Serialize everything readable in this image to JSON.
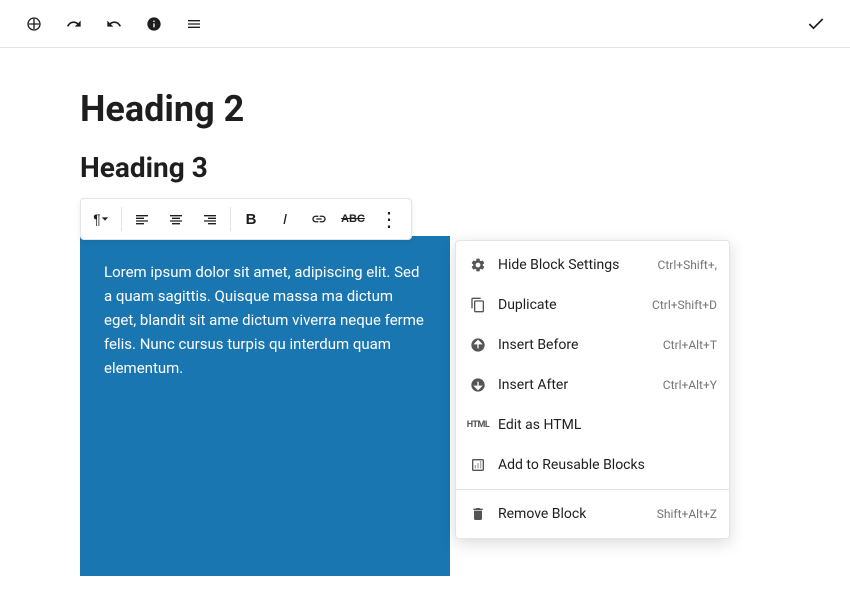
{
  "toolbar": {
    "add_icon": "⊕",
    "undo_icon": "↩",
    "redo_icon": "↪",
    "info_icon": "ⓘ",
    "list_icon": "≡",
    "check_icon": "✓"
  },
  "editor": {
    "heading2": "Heading 2",
    "heading3": "Heading 3",
    "content": "Lorem ipsum dolor sit amet, adipiscing elit. Sed a quam sagittis. Quisque massa ma dictum eget, blandit sit ame dictum viverra neque ferme felis. Nunc cursus turpis qu interdum quam elementum."
  },
  "block_toolbar": {
    "paragraph": "¶",
    "align_left": "≡",
    "align_center": "≡",
    "align_right": "≡",
    "bold": "B",
    "italic": "I",
    "link": "⛓",
    "strikethrough": "ABC",
    "more": "⋮"
  },
  "context_menu": {
    "items": [
      {
        "id": "hide-block-settings",
        "label": "Hide Block Settings",
        "shortcut": "Ctrl+Shift+,",
        "icon": "gear"
      },
      {
        "id": "duplicate",
        "label": "Duplicate",
        "shortcut": "Ctrl+Shift+D",
        "icon": "duplicate"
      },
      {
        "id": "insert-before",
        "label": "Insert Before",
        "shortcut": "Ctrl+Alt+T",
        "icon": "insert-before"
      },
      {
        "id": "insert-after",
        "label": "Insert After",
        "shortcut": "Ctrl+Alt+Y",
        "icon": "insert-after"
      },
      {
        "id": "edit-as-html",
        "label": "Edit as HTML",
        "shortcut": "",
        "icon": "html"
      },
      {
        "id": "add-to-reusable-blocks",
        "label": "Add to Reusable Blocks",
        "shortcut": "",
        "icon": "reusable"
      },
      {
        "id": "remove-block",
        "label": "Remove Block",
        "shortcut": "Shift+Alt+Z",
        "icon": "trash"
      }
    ]
  }
}
